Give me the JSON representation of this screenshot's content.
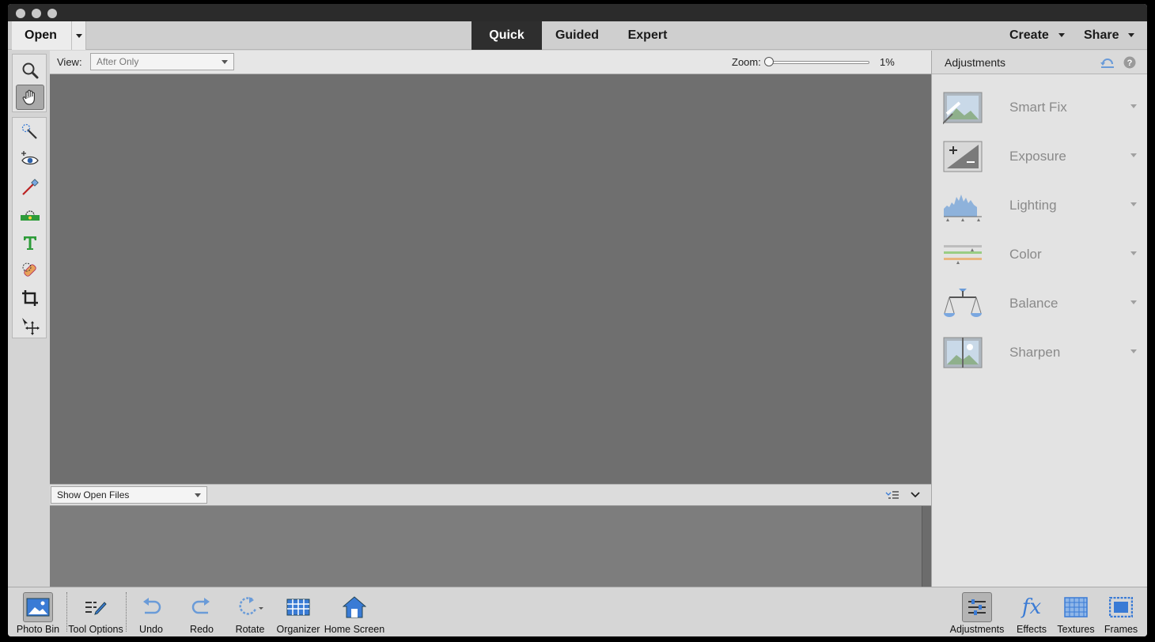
{
  "topbar": {
    "open_label": "Open",
    "tabs": [
      "Quick",
      "Guided",
      "Expert"
    ],
    "active_tab": "Quick",
    "create_label": "Create",
    "share_label": "Share"
  },
  "tools": [
    {
      "icon": "zoom-icon"
    },
    {
      "icon": "hand-icon",
      "selected": true
    },
    {
      "icon": "quick-selection-icon"
    },
    {
      "icon": "red-eye-icon"
    },
    {
      "icon": "whiten-teeth-icon"
    },
    {
      "icon": "straighten-icon"
    },
    {
      "icon": "type-icon"
    },
    {
      "icon": "spot-healing-icon"
    },
    {
      "icon": "crop-icon"
    },
    {
      "icon": "move-icon"
    }
  ],
  "options_bar": {
    "view_label": "View:",
    "view_value": "After Only",
    "zoom_label": "Zoom:",
    "zoom_value": "1%",
    "zoom_level": 0.01
  },
  "bin": {
    "dropdown_value": "Show Open Files"
  },
  "panel": {
    "title": "Adjustments",
    "items": [
      {
        "label": "Smart Fix",
        "icon": "smart-fix-icon"
      },
      {
        "label": "Exposure",
        "icon": "exposure-icon"
      },
      {
        "label": "Lighting",
        "icon": "lighting-icon"
      },
      {
        "label": "Color",
        "icon": "color-icon"
      },
      {
        "label": "Balance",
        "icon": "balance-icon"
      },
      {
        "label": "Sharpen",
        "icon": "sharpen-icon"
      }
    ]
  },
  "bottom": {
    "left": [
      {
        "label": "Photo Bin",
        "icon": "photo-bin-icon"
      },
      {
        "label": "Tool Options",
        "icon": "tool-options-icon"
      },
      {
        "label": "Undo",
        "icon": "undo-icon"
      },
      {
        "label": "Redo",
        "icon": "redo-icon"
      },
      {
        "label": "Rotate",
        "icon": "rotate-icon"
      },
      {
        "label": "Organizer",
        "icon": "organizer-icon"
      },
      {
        "label": "Home Screen",
        "icon": "home-icon"
      }
    ],
    "right": [
      {
        "label": "Adjustments",
        "icon": "adjustments-icon"
      },
      {
        "label": "Effects",
        "icon": "effects-icon"
      },
      {
        "label": "Textures",
        "icon": "textures-icon"
      },
      {
        "label": "Frames",
        "icon": "frames-icon"
      }
    ]
  },
  "colors": {
    "canvas": "#6f6f6f",
    "active_tab": "#2e2e2e",
    "icon_blue": "#3a7bd5"
  }
}
